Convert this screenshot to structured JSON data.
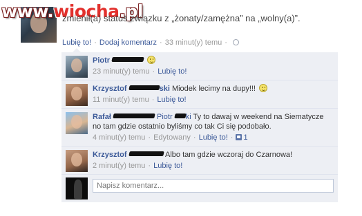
{
  "watermark": {
    "text_a": "www.",
    "text_b": "wiocha",
    "text_c": ".pl"
  },
  "status": {
    "text": "zmienił(a) status związku z „żonaty/zamężna” na „wolny(a)”."
  },
  "actions": {
    "like": "Lubię to!",
    "comment": "Dodaj komentarz",
    "time": "33 minut(y) temu"
  },
  "comments": [
    {
      "author": "Piotr",
      "text": "",
      "time": "23 minut(y) temu",
      "like": "Lubię to!"
    },
    {
      "author": "Krzysztof",
      "author_tail": "ski",
      "text": "Miodek lecimy na dupy!!!",
      "time": "11 minut(y) temu",
      "like": "Lubię to!"
    },
    {
      "author": "Rafał",
      "mention": "Piotr",
      "mention_tail": "ki",
      "text": "Ty to dawaj w weekend na Siematycze no tam gdzie ostatnio byliśmy co tak Ci się podobało.",
      "time": "4 minut(y) temu",
      "edited": "Edytowany",
      "like": "Lubię to!",
      "like_count": "1"
    },
    {
      "author": "Krzysztof",
      "text": "Albo tam gdzie wczoraj do Czarnowa!",
      "time": "2 minut(y) temu",
      "like": "Lubię to!"
    }
  ],
  "comment_input": {
    "placeholder": "Napisz komentarz..."
  }
}
